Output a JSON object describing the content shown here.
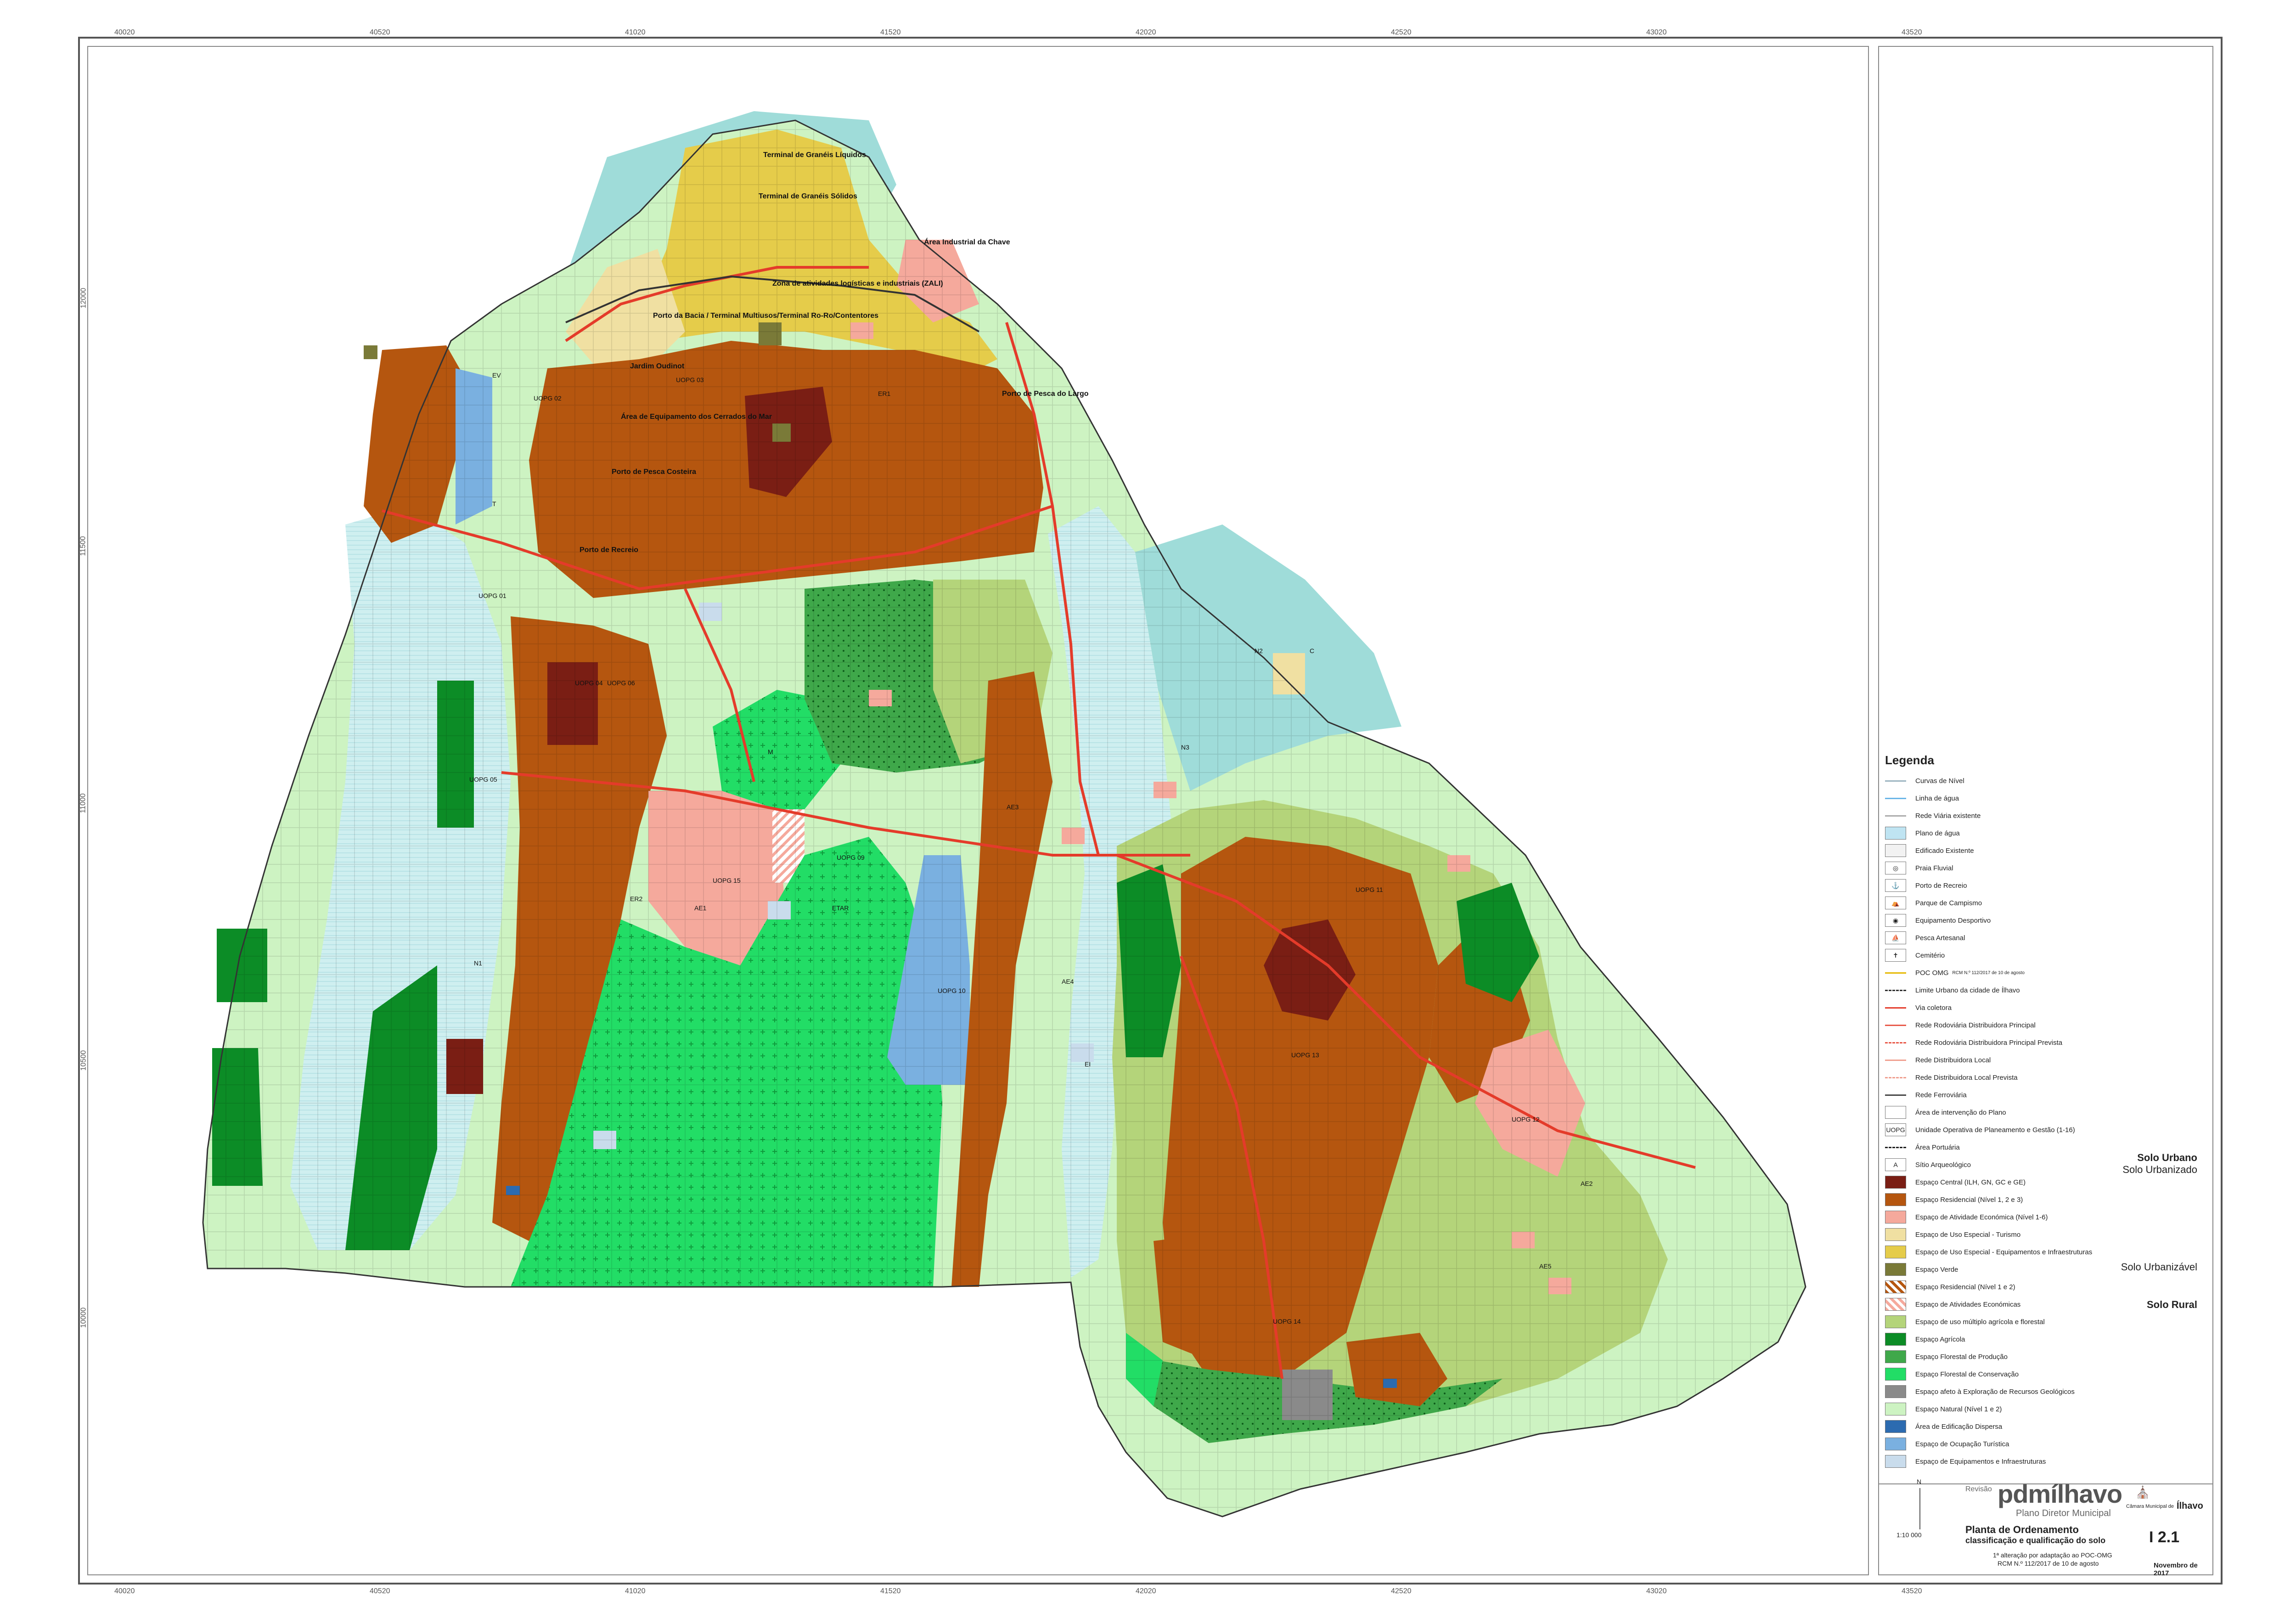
{
  "map": {
    "coords_top": [
      "40020",
      "40520",
      "41020",
      "41520",
      "42020",
      "42520",
      "43020",
      "43520"
    ],
    "coords_bottom": [
      "40020",
      "40520",
      "41020",
      "41520",
      "42020",
      "42520",
      "43020",
      "43520"
    ],
    "coords_left": [
      "10000",
      "10500",
      "11000",
      "11500",
      "12000",
      "12500",
      "13000"
    ],
    "labels": [
      {
        "text": "Terminal de Granéis Líquidos",
        "cls": "b"
      },
      {
        "text": "Terminal de Granéis Sólidos",
        "cls": "b"
      },
      {
        "text": "Área Industrial da Chave",
        "cls": "b"
      },
      {
        "text": "Zona de atividades logísticas e industriais (ZALI)",
        "cls": "b"
      },
      {
        "text": "Porto da Bacia / Terminal Multiusos/Terminal Ro-Ro/Contentores",
        "cls": "b"
      },
      {
        "text": "Jardim Oudinot",
        "cls": "b"
      },
      {
        "text": "Área de Equipamento dos Cerrados do Mar",
        "cls": "b"
      },
      {
        "text": "Porto de Pesca Costeira",
        "cls": "b"
      },
      {
        "text": "Porto de Pesca do Largo",
        "cls": "b"
      },
      {
        "text": "Porto de Recreio",
        "cls": "b"
      },
      {
        "text": "UOPG 01",
        "cls": ""
      },
      {
        "text": "UOPG 02",
        "cls": ""
      },
      {
        "text": "UOPG 03",
        "cls": ""
      },
      {
        "text": "UOPG 04",
        "cls": ""
      },
      {
        "text": "UOPG 05",
        "cls": ""
      },
      {
        "text": "UOPG 06",
        "cls": ""
      },
      {
        "text": "UOPG 09",
        "cls": ""
      },
      {
        "text": "UOPG 10",
        "cls": ""
      },
      {
        "text": "UOPG 11",
        "cls": ""
      },
      {
        "text": "UOPG 12",
        "cls": ""
      },
      {
        "text": "UOPG 13",
        "cls": ""
      },
      {
        "text": "UOPG 14",
        "cls": ""
      },
      {
        "text": "UOPG 15",
        "cls": ""
      },
      {
        "text": "ETAR",
        "cls": ""
      },
      {
        "text": "N1",
        "cls": ""
      },
      {
        "text": "N2",
        "cls": ""
      },
      {
        "text": "N3",
        "cls": ""
      },
      {
        "text": "ER1",
        "cls": ""
      },
      {
        "text": "ER2",
        "cls": ""
      },
      {
        "text": "AE1",
        "cls": ""
      },
      {
        "text": "AE2",
        "cls": ""
      },
      {
        "text": "AE3",
        "cls": ""
      },
      {
        "text": "AE4",
        "cls": ""
      },
      {
        "text": "AE5",
        "cls": ""
      },
      {
        "text": "EV",
        "cls": ""
      },
      {
        "text": "EI",
        "cls": ""
      },
      {
        "text": "M",
        "cls": ""
      },
      {
        "text": "T",
        "cls": ""
      },
      {
        "text": "C",
        "cls": ""
      }
    ]
  },
  "colors": {
    "water": "#9fdcd9",
    "river": "#cfeff0",
    "residential": "#b5560f",
    "central": "#7a1e14",
    "economic": "#f5a99c",
    "tourism": "#f0e0a2",
    "infrastructure": "#e5cc4a",
    "green": "#7a7a38",
    "multiuse": "#b4d47a",
    "agricultural": "#0c8c26",
    "forest_production": "#3fa84a",
    "forest_conservation": "#22dd66",
    "geological": "#8a8a8a",
    "natural": "#cdf3c2",
    "dispersed": "#2c6bb0",
    "tourist": "#7ab0e0",
    "equipment": "#c9dcec",
    "road": "#e43b2a"
  },
  "legend": {
    "title": "Legenda",
    "items": [
      {
        "type": "line",
        "color": "#9bb3c0",
        "label": "Curvas de Nível"
      },
      {
        "type": "line",
        "color": "#6bb6e8",
        "label": "Linha de água"
      },
      {
        "type": "line",
        "color": "#aaaaaa",
        "label": "Rede Viária existente"
      },
      {
        "type": "fill",
        "color": "#bfe4f2",
        "label": "Plano de água"
      },
      {
        "type": "fill",
        "color": "#f2f2f2",
        "label": "Edificado Existente"
      },
      {
        "type": "symbol",
        "symbol": "◎",
        "label": "Praia Fluvial"
      },
      {
        "type": "symbol",
        "symbol": "⚓",
        "label": "Porto de Recreio"
      },
      {
        "type": "symbol",
        "symbol": "⛺",
        "label": "Parque de Campismo"
      },
      {
        "type": "symbol",
        "symbol": "◉",
        "label": "Equipamento Desportivo"
      },
      {
        "type": "symbol",
        "symbol": "⛵",
        "label": "Pesca Artesanal"
      },
      {
        "type": "symbol",
        "symbol": "✝",
        "label": "Cemitério"
      },
      {
        "type": "line",
        "color": "#e6b800",
        "label": "POC OMG",
        "note": "RCM N.º 112/2017 de 10 de agosto"
      },
      {
        "type": "dashline",
        "color": "#333333",
        "label": "Limite Urbano da cidade de Ílhavo"
      },
      {
        "type": "line",
        "color": "#e43b2a",
        "label": "Via coletora"
      },
      {
        "type": "line",
        "color": "#e85a4a",
        "label": "Rede Rodoviária Distribuidora Principal"
      },
      {
        "type": "dashline",
        "color": "#e85a4a",
        "label": "Rede Rodoviária Distribuidora Principal Prevista"
      },
      {
        "type": "line",
        "color": "#f0a090",
        "label": "Rede Distribuidora Local"
      },
      {
        "type": "dashline",
        "color": "#f0a090",
        "label": "Rede Distribuidora Local Prevista"
      },
      {
        "type": "line",
        "color": "#444444",
        "label": "Rede Ferroviária"
      },
      {
        "type": "fill",
        "color": "#ffffff",
        "label": "Área de intervenção do Plano"
      },
      {
        "type": "symbol",
        "symbol": "UOPG",
        "label": "Unidade Operativa de Planeamento e Gestão (1-16)"
      },
      {
        "type": "dashline",
        "color": "#222222",
        "label": "Área Portuária"
      },
      {
        "type": "symbol",
        "symbol": "A",
        "label": "Sítio Arqueológico"
      },
      {
        "type": "fill",
        "color": "#7a1e14",
        "label": "Espaço Central (ILH, GN, GC e GE)"
      },
      {
        "type": "fill",
        "color": "#b5560f",
        "label": "Espaço Residencial (Nível 1, 2 e 3)"
      },
      {
        "type": "fill",
        "color": "#f5a99c",
        "label": "Espaço de Atividade Económica (Nível 1-6)"
      },
      {
        "type": "fill",
        "color": "#f0e0a2",
        "label": "Espaço de Uso Especial - Turismo"
      },
      {
        "type": "fill",
        "color": "#e5cc4a",
        "label": "Espaço de Uso Especial - Equipamentos e Infraestruturas"
      },
      {
        "type": "fill",
        "color": "#7a7a38",
        "label": "Espaço Verde"
      },
      {
        "type": "hatch",
        "color": "#b5560f",
        "label": "Espaço Residencial (Nível 1 e 2)"
      },
      {
        "type": "hatch",
        "color": "#f5a99c",
        "label": "Espaço de Atividades Económicas"
      },
      {
        "type": "fill",
        "color": "#b4d47a",
        "label": "Espaço de uso múltiplo agrícola e florestal"
      },
      {
        "type": "fill",
        "color": "#0c8c26",
        "label": "Espaço Agrícola"
      },
      {
        "type": "fill",
        "color": "#3fa84a",
        "label": "Espaço Florestal de Produção"
      },
      {
        "type": "fill",
        "color": "#22dd66",
        "label": "Espaço Florestal de Conservação"
      },
      {
        "type": "fill",
        "color": "#8a8a8a",
        "label": "Espaço afeto à Exploração de Recursos Geológicos"
      },
      {
        "type": "fill",
        "color": "#cdf3c2",
        "label": "Espaço Natural (Nível 1 e 2)"
      },
      {
        "type": "fill",
        "color": "#2c6bb0",
        "label": "Área de Edificação Dispersa"
      },
      {
        "type": "fill",
        "color": "#7ab0e0",
        "label": "Espaço de Ocupação Turística"
      },
      {
        "type": "fill",
        "color": "#c9dcec",
        "label": "Espaço de Equipamentos e Infraestruturas"
      }
    ],
    "sections": {
      "solo_urbano": "Solo Urbano",
      "solo_urbanizado": "Solo Urbanizado",
      "solo_urbanizavel": "Solo Urbanizável",
      "solo_rural": "Solo Rural"
    }
  },
  "titleblock": {
    "revisao": "Revisão",
    "logo": "pdmílhavo",
    "logo_sub": "Plano Diretor Municipal",
    "camara": "Câmara Municipal de",
    "camara_name": "Ílhavo",
    "scale": "1:10 000",
    "north": "N",
    "title": "Planta de Ordenamento",
    "subtitle": "classificação e qualificação do solo",
    "alteracao": "1ª alteração por adaptação ao POC-OMG",
    "rcm": "RCM N.º 112/2017 de 10 de agosto",
    "sheet": "I 2.1",
    "date": "Novembro de 2017"
  }
}
